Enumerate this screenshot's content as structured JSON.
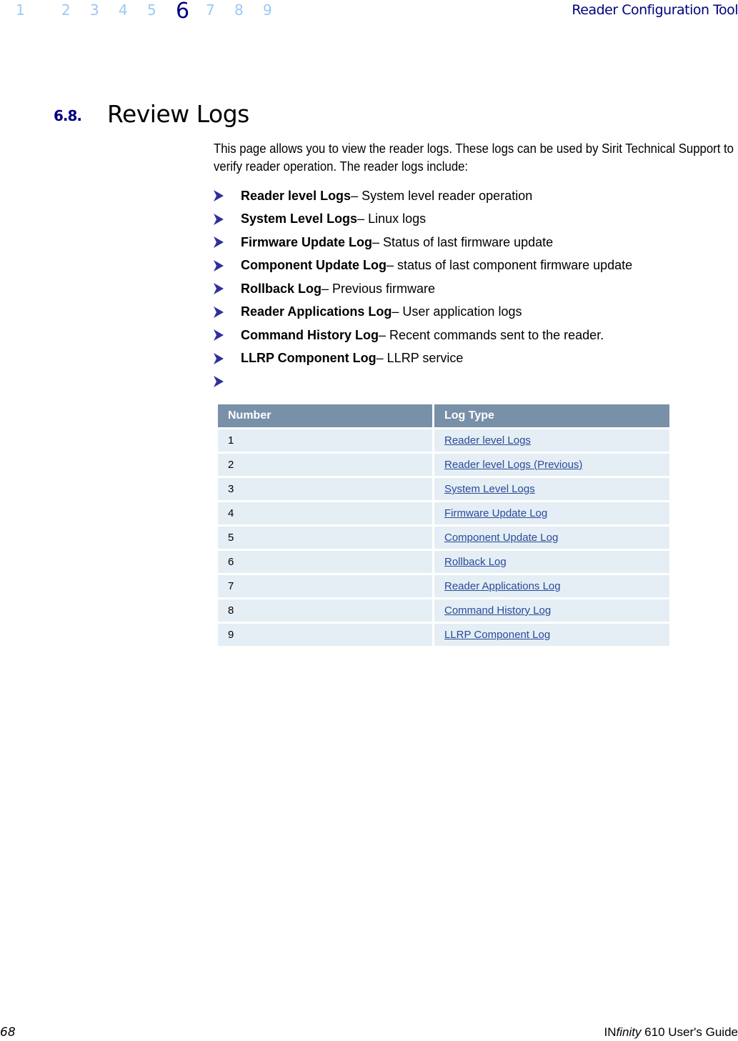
{
  "header": {
    "chapters": [
      "1",
      "2",
      "3",
      "4",
      "5",
      "6",
      "7",
      "8",
      "9"
    ],
    "active_chapter": "6",
    "running_title": "Reader Configuration Tool"
  },
  "section": {
    "number": "6.8.",
    "title": "Review Logs"
  },
  "intro": "This page allows you to view the reader logs. These logs can be used by Sirit Technical Support to verify reader operation. The reader logs include:",
  "bullets": [
    {
      "term": "Reader level Logs",
      "desc": " – System level reader operation"
    },
    {
      "term": "System Level Logs",
      "desc": " – Linux logs"
    },
    {
      "term": "Firmware Update Log",
      "desc": " – Status of last firmware update"
    },
    {
      "term": "Component Update Log",
      "desc": " – status of last component firmware update"
    },
    {
      "term": "Rollback Log",
      "desc": " – Previous firmware"
    },
    {
      "term": "Reader Applications Log",
      "desc": " – User application logs"
    },
    {
      "term": "Command History Log",
      "desc": " – Recent commands sent to the reader."
    },
    {
      "term": "LLRP Component Log",
      "desc": " – LLRP service"
    },
    {
      "term": "",
      "desc": ""
    }
  ],
  "table": {
    "headers": [
      "Number",
      "Log Type"
    ],
    "rows": [
      {
        "number": "1",
        "log_type": "Reader level Logs"
      },
      {
        "number": "2",
        "log_type": "Reader level Logs (Previous)"
      },
      {
        "number": "3",
        "log_type": "System Level Logs"
      },
      {
        "number": "4",
        "log_type": "Firmware Update Log"
      },
      {
        "number": "5",
        "log_type": "Component Update Log"
      },
      {
        "number": "6",
        "log_type": "Rollback Log"
      },
      {
        "number": "7",
        "log_type": "Reader Applications Log"
      },
      {
        "number": "8",
        "log_type": "Command History Log"
      },
      {
        "number": "9",
        "log_type": "LLRP Component Log"
      }
    ]
  },
  "footer": {
    "page_number": "68",
    "product_prefix": "IN",
    "product_italic": "finity",
    "product_suffix": " 610 User's Guide"
  },
  "colors": {
    "nav_inactive": "#9cc8f4",
    "nav_active": "#000080",
    "table_header_bg": "#7890a8",
    "table_row_bg": "#e4eef4",
    "link": "#2a4a9a",
    "bullet_arrow": "#2e2e9e"
  }
}
